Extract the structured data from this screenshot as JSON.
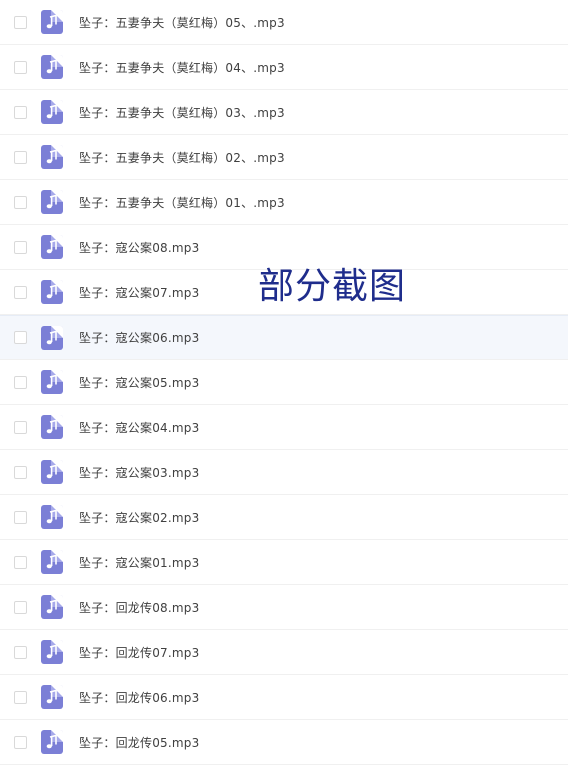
{
  "files": [
    {
      "name": "坠子：五妻争夫（莫红梅）05、.mp3"
    },
    {
      "name": "坠子：五妻争夫（莫红梅）04、.mp3"
    },
    {
      "name": "坠子：五妻争夫（莫红梅）03、.mp3"
    },
    {
      "name": "坠子：五妻争夫（莫红梅）02、.mp3"
    },
    {
      "name": "坠子：五妻争夫（莫红梅）01、.mp3"
    },
    {
      "name": "坠子：寇公案08.mp3"
    },
    {
      "name": "坠子：寇公案07.mp3"
    },
    {
      "name": "坠子：寇公案06.mp3"
    },
    {
      "name": "坠子：寇公案05.mp3"
    },
    {
      "name": "坠子：寇公案04.mp3"
    },
    {
      "name": "坠子：寇公案03.mp3"
    },
    {
      "name": "坠子：寇公案02.mp3"
    },
    {
      "name": "坠子：寇公案01.mp3"
    },
    {
      "name": "坠子：回龙传08.mp3"
    },
    {
      "name": "坠子：回龙传07.mp3"
    },
    {
      "name": "坠子：回龙传06.mp3"
    },
    {
      "name": "坠子：回龙传05.mp3"
    }
  ],
  "watermark": "部分截图",
  "icon": "music-file-icon",
  "colors": {
    "icon_bg": "#7b7fd6",
    "hover_bg": "#f4f7fc",
    "watermark": "#1f2d8c"
  }
}
